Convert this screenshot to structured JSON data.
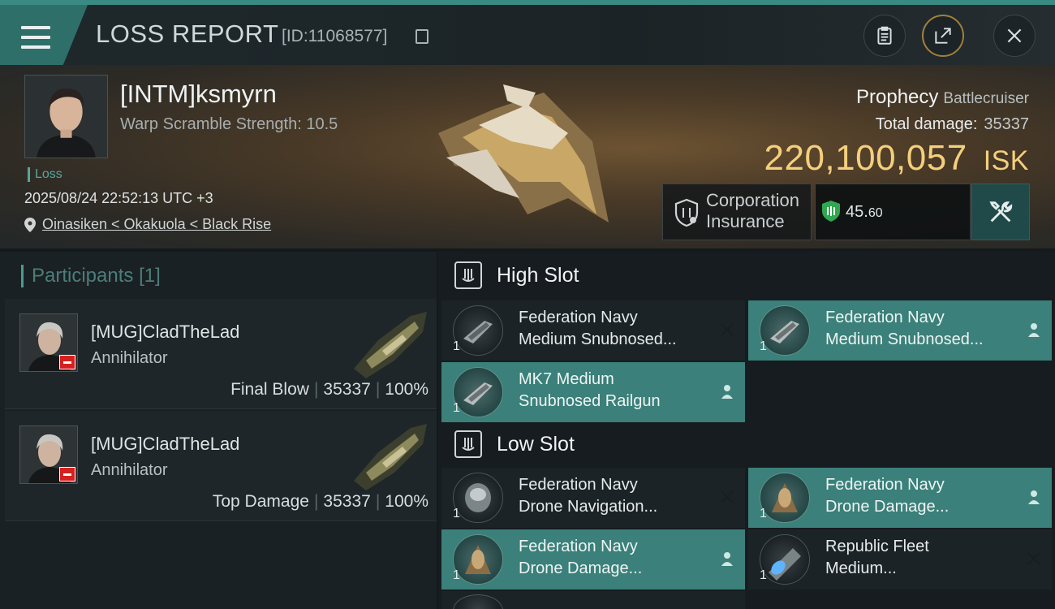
{
  "header": {
    "title": "LOSS REPORT",
    "report_id": "[ID:11068577]"
  },
  "victim": {
    "name": "[INTM]ksmyrn",
    "warp_scramble": "Warp Scramble Strength: 10.5",
    "tag": "Loss",
    "datetime": "2025/08/24 22:52:13 UTC +3",
    "location": "Oinasiken < Okakuola < Black Rise",
    "ship_name": "Prophecy",
    "ship_class": "Battlecruiser",
    "total_damage_label": "Total damage:",
    "total_damage_value": "35337",
    "isk_value": "220,100,057",
    "isk_unit": "ISK",
    "insurance_line1": "Corporation",
    "insurance_line2": "Insurance",
    "security_value": "45.",
    "security_decimals": "60"
  },
  "participants": {
    "heading": "Participants",
    "count": "[1]",
    "items": [
      {
        "name": "[MUG]CladTheLad",
        "ship": "Annihilator",
        "role": "Final Blow",
        "damage": "35337",
        "percent": "100%"
      },
      {
        "name": "[MUG]CladTheLad",
        "ship": "Annihilator",
        "role": "Top Damage",
        "damage": "35337",
        "percent": "100%"
      }
    ]
  },
  "slots": {
    "high": {
      "label": "High Slot",
      "items": [
        {
          "line1": "Federation Navy",
          "line2": "Medium Snubnosed...",
          "qty": "1",
          "status": "destroyed"
        },
        {
          "line1": "Federation Navy",
          "line2": "Medium Snubnosed...",
          "qty": "1",
          "status": "dropped"
        },
        {
          "line1": "MK7 Medium",
          "line2": "Snubnosed Railgun",
          "qty": "1",
          "status": "dropped"
        }
      ]
    },
    "low": {
      "label": "Low Slot",
      "items": [
        {
          "line1": "Federation Navy",
          "line2": "Drone Navigation...",
          "qty": "1",
          "status": "destroyed"
        },
        {
          "line1": "Federation Navy",
          "line2": "Drone Damage...",
          "qty": "1",
          "status": "dropped"
        },
        {
          "line1": "Federation Navy",
          "line2": "Drone Damage...",
          "qty": "1",
          "status": "dropped"
        },
        {
          "line1": "Republic Fleet",
          "line2": "Medium...",
          "qty": "1",
          "status": "destroyed"
        }
      ]
    }
  },
  "colors": {
    "accent": "#3b807a",
    "isk": "#f4cf7c",
    "loss_badge": "#d62020"
  }
}
